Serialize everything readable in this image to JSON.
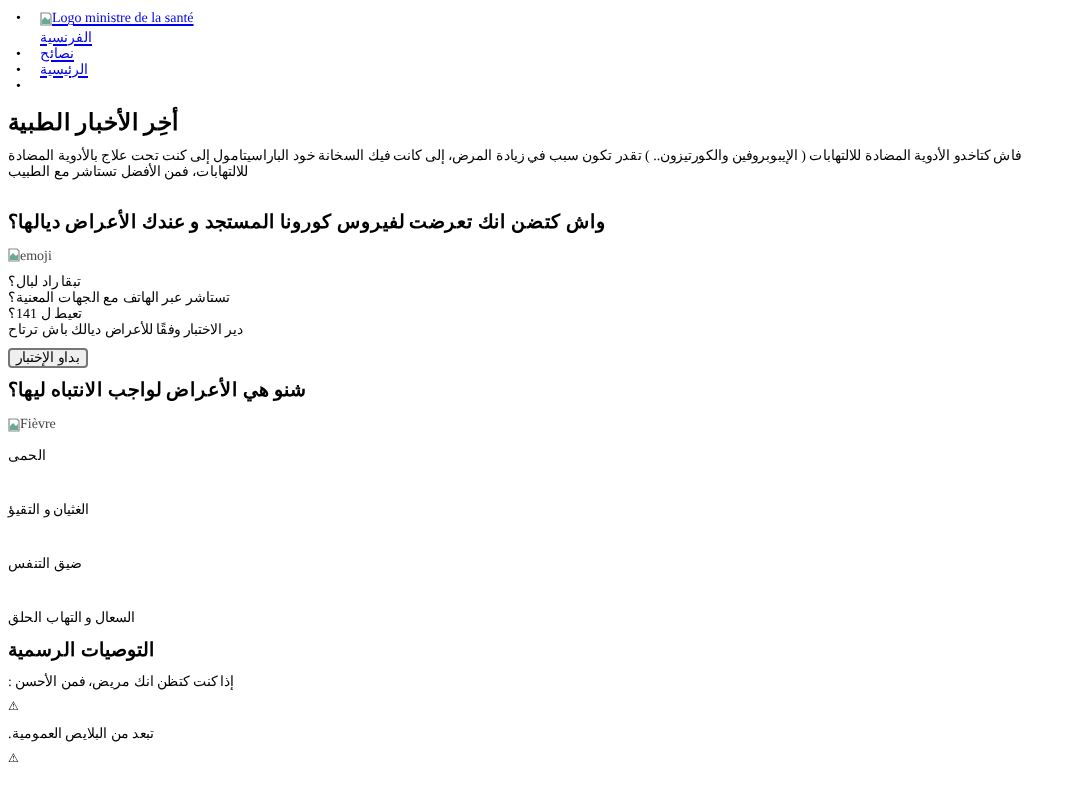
{
  "nav": [
    {
      "kind": "logo",
      "marker": "•",
      "alt": "Logo ministre de la santé",
      "label": "الفرنسية"
    },
    {
      "kind": "link",
      "marker": "•",
      "label": "نصائح"
    },
    {
      "kind": "link",
      "marker": "•",
      "label": "الرئيسية"
    },
    {
      "kind": "empty",
      "marker": "•"
    }
  ],
  "news": {
    "title": "أخِر الأخبار الطبية",
    "text": "فاش كتاخدو الأدوية المضادة للالتهابات ( الإيبوبروفين والكورتيزون.. ) تقدر تكون سبب في زيادة المرض، إلى كانت فيك السخانة خود الباراسيتامول إلى كنت تحت علاج بالأدوية المضادة للالتهابات، فمن الأفضل تستاشر مع الطبيب"
  },
  "test": {
    "title": "واش كتضن انك تعرضت لفيروس كورونا المستجد و عندك الأعراض ديالها؟",
    "image_alt": "emoji",
    "lines": [
      "تبقا راد لبال؟",
      "تستاشر عبر الهاتف مع الجهات المعنية؟",
      "تعيط ل 141؟",
      "دير الاختبار وفقًا للأعراض ديالك باش ترتاح"
    ],
    "button": "بداو الإختبار"
  },
  "symptoms": {
    "title": "شنو هي الأعراض لواجب الانتباه ليها؟",
    "image_alt": "Fièvre",
    "items": [
      "الحمى",
      "الغثيان و التقيؤ",
      "ضيق التنفس",
      "السعال و التهاب الحلق"
    ]
  },
  "advice": {
    "title": "التوصيات الرسمية",
    "items": [
      {
        "kind": "text",
        "text": "إذا كنت كتظن انك مريض، فمن الأحسن :"
      },
      {
        "kind": "symbol",
        "text": "⚠"
      },
      {
        "kind": "text",
        "text": "تبعد من البلايص العمومية."
      },
      {
        "kind": "symbol",
        "text": "⚠"
      }
    ]
  }
}
